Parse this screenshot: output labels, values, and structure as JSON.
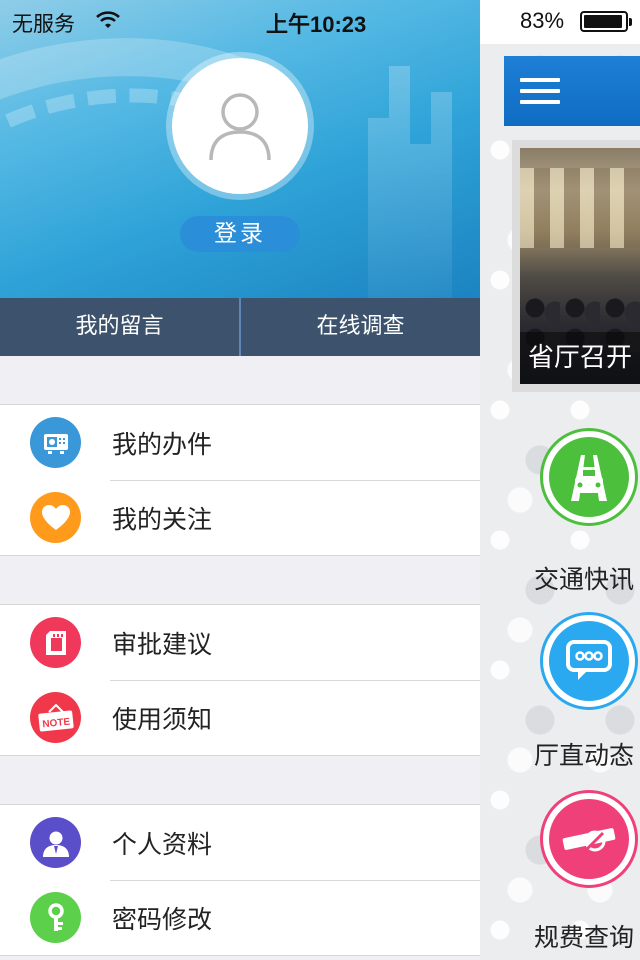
{
  "status_bar": {
    "carrier": "无服务",
    "time": "上午10:23",
    "battery": "83%"
  },
  "profile": {
    "login_label": "登录",
    "tabs": [
      {
        "label": "我的留言"
      },
      {
        "label": "在线调查"
      }
    ]
  },
  "menu": {
    "groups": [
      {
        "items": [
          {
            "label": "我的办件",
            "icon": "case-file-icon",
            "color": "#3a98d8"
          },
          {
            "label": "我的关注",
            "icon": "heart-icon",
            "color": "#ff9a1a"
          }
        ]
      },
      {
        "items": [
          {
            "label": "审批建议",
            "icon": "document-icon",
            "color": "#f0385a"
          },
          {
            "label": "使用须知",
            "icon": "note-sign-icon",
            "color": "#f0384a",
            "icon_text": "NOTE"
          }
        ]
      },
      {
        "items": [
          {
            "label": "个人资料",
            "icon": "person-icon",
            "color": "#5a4fc8"
          },
          {
            "label": "密码修改",
            "icon": "key-icon",
            "color": "#5cd04a"
          }
        ]
      }
    ]
  },
  "background_app": {
    "news_caption": "省厅召开",
    "features": [
      {
        "label": "交通快讯",
        "icon": "car-road-icon",
        "color": "#4cbf3c"
      },
      {
        "label": "厅直动态",
        "icon": "chat-bubble-icon",
        "color": "#2aa8f0"
      },
      {
        "label": "规费查询",
        "icon": "toll-barrier-icon",
        "color": "#f0407a"
      }
    ]
  }
}
